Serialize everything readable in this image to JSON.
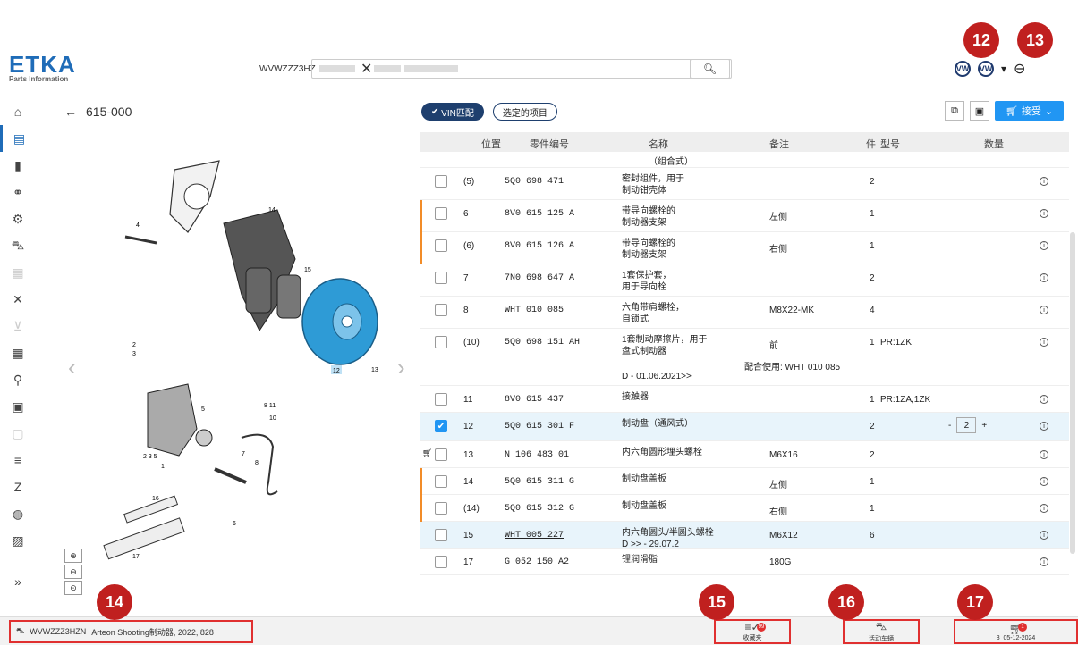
{
  "app": {
    "logo": "ETKA",
    "logo_sub": "Parts Information"
  },
  "search": {
    "vin_label": "WVWZZZ3HZ",
    "value": "WVWZZZ3HZ",
    "placeholder": "...",
    "clear_icon": "close-icon",
    "search_icon": "search-icon"
  },
  "brand": {
    "icons": [
      "vw-logo",
      "vw-logo"
    ],
    "dropdown": "▾"
  },
  "breadcrumb": {
    "code": "615-000"
  },
  "filters": [
    {
      "label": "VIN匹配",
      "active": true
    },
    {
      "label": "选定的项目",
      "active": false
    }
  ],
  "toolbar": {
    "accept_label": "接受"
  },
  "table": {
    "headers": [
      "位置",
      "零件编号",
      "名称",
      "备注",
      "件",
      "型号",
      "数量"
    ],
    "partial_top": "（组合式）",
    "rows": [
      {
        "pos": "(5)",
        "part": "5Q0 698 471",
        "name": "密封组件，用于\n制动钳壳体",
        "note": "",
        "qty": "2",
        "model": "",
        "orange": false
      },
      {
        "pos": "6",
        "part": "8V0 615 125 A",
        "name": "带导向螺栓的\n制动器支架",
        "note": "左侧",
        "qty": "1",
        "model": "",
        "orange": true
      },
      {
        "pos": "(6)",
        "part": "8V0 615 126 A",
        "name": "带导向螺栓的\n制动器支架",
        "note": "右侧",
        "qty": "1",
        "model": "",
        "orange": true
      },
      {
        "pos": "7",
        "part": "7N0 698 647 A",
        "name": "1套保护套，\n用于导向栓",
        "note": "",
        "qty": "2",
        "model": "",
        "orange": false
      },
      {
        "pos": "8",
        "part": "WHT 010 085",
        "name": "六角带肩螺栓，\n自锁式",
        "note": "M8X22-MK",
        "qty": "4",
        "model": "",
        "orange": false
      },
      {
        "pos": "(10)",
        "part": "5Q0 698 151 AH",
        "name": "1套制动摩擦片，用于\n盘式制动器",
        "note": "前",
        "qty": "1",
        "model": "PR:1ZK",
        "orange": false,
        "extra1": "配合使用: WHT 010 085",
        "extra2": "D - 01.06.2021>>"
      },
      {
        "pos": "11",
        "part": "8V0 615 437",
        "name": "接触器",
        "note": "",
        "qty": "1",
        "model": "PR:1ZA,1ZK",
        "orange": false
      },
      {
        "pos": "12",
        "part": "5Q0 615 301 F",
        "name": "制动盘（通风式）",
        "note": "",
        "qty": "2",
        "model": "",
        "orange": false,
        "selected": true,
        "stepper": "2"
      },
      {
        "pos": "13",
        "part": "N   106 483 01",
        "name": "内六角圆形埋头螺栓",
        "note": "M6X16",
        "qty": "2",
        "model": "",
        "orange": false,
        "cart": true
      },
      {
        "pos": "14",
        "part": "5Q0 615 311 G",
        "name": "制动盘盖板",
        "note": "左侧",
        "qty": "1",
        "model": "",
        "orange": true
      },
      {
        "pos": "(14)",
        "part": "5Q0 615 312 G",
        "name": "制动盘盖板",
        "note": "右侧",
        "qty": "1",
        "model": "",
        "orange": true
      },
      {
        "pos": "15",
        "part": "WHT 005 227",
        "name": "内六角圆头/半圆头螺栓\nD >> - 29.07.2",
        "note": "M6X12",
        "qty": "6",
        "model": "",
        "orange": false,
        "highlight": true
      },
      {
        "pos": "17",
        "part": "G   052 150 A2",
        "name": "锂润滑脂",
        "note": "180G",
        "qty": "",
        "model": "",
        "orange": false
      }
    ]
  },
  "bottom": {
    "vin_text": "WVWZZZ3HZN",
    "vehicle": "Arteon Shooting制动器, 2022, 828",
    "favorites": "收藏夹",
    "favorites_count": "99",
    "active_vehicle": "活动车辆",
    "cart_date": "3_05-12-2024",
    "cart_count": "1"
  },
  "badges": [
    "12",
    "13",
    "14",
    "15",
    "16",
    "17"
  ],
  "diagram_labels": [
    "14",
    "4",
    "15",
    "12",
    "13",
    "2",
    "3",
    "11",
    "10",
    "8",
    "11",
    "5",
    "8",
    "2",
    "3",
    "5",
    "1",
    "7",
    "8",
    "6",
    "16",
    "17"
  ],
  "colors": {
    "accent": "#2196f3",
    "badge": "#c0201f",
    "selected_row": "#e8f4fb",
    "orange_marker": "#f28c28"
  }
}
